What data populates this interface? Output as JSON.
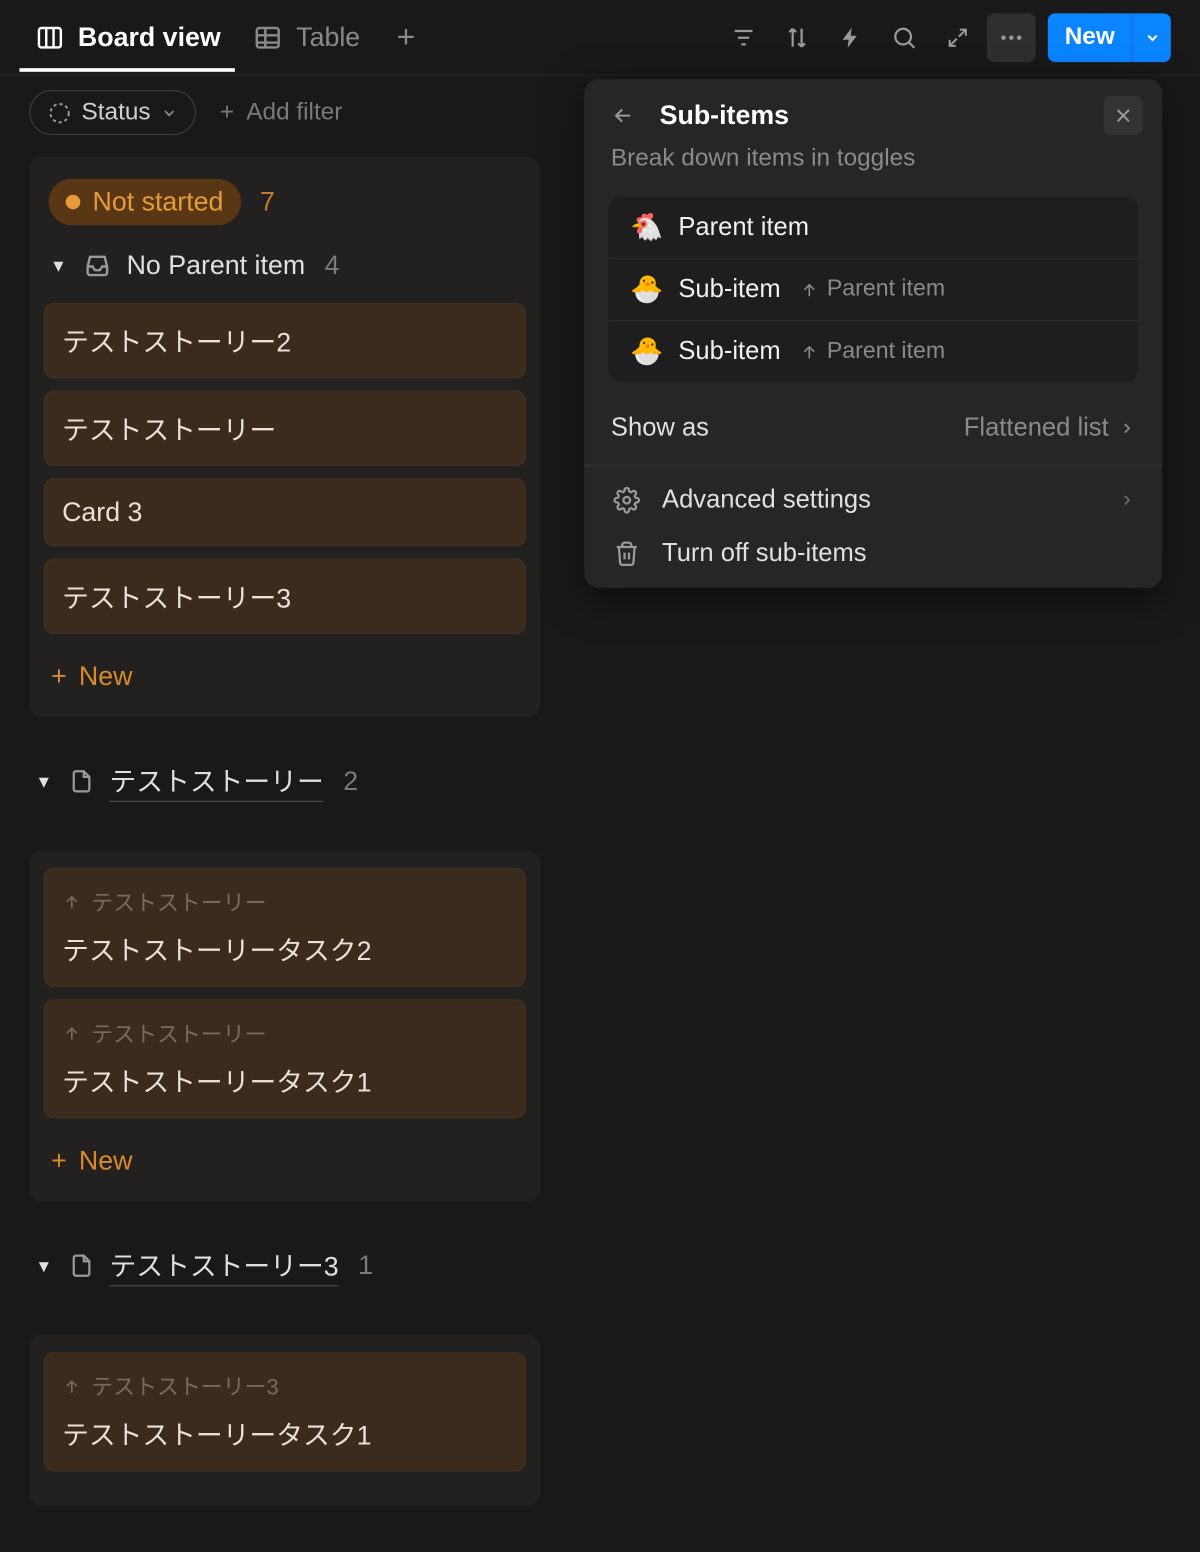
{
  "tabs": {
    "board": "Board view",
    "table": "Table"
  },
  "top": {
    "new_button": "New"
  },
  "filter_bar": {
    "status_chip": "Status",
    "add_filter": "Add filter"
  },
  "status": {
    "label": "Not started",
    "count": "7"
  },
  "groups": [
    {
      "icon": "inbox",
      "title": "No Parent item",
      "count": "4",
      "cards": [
        {
          "title": "テストストーリー2"
        },
        {
          "title": "テストストーリー"
        },
        {
          "title": "Card 3"
        },
        {
          "title": "テストストーリー3"
        }
      ]
    },
    {
      "icon": "page",
      "title": "テストストーリー",
      "count": "2",
      "cards": [
        {
          "parent": "テストストーリー",
          "title": "テストストーリータスク2"
        },
        {
          "parent": "テストストーリー",
          "title": "テストストーリータスク1"
        }
      ]
    },
    {
      "icon": "page",
      "title": "テストストーリー3",
      "count": "1",
      "cards": [
        {
          "parent": "テストストーリー3",
          "title": "テストストーリータスク1"
        }
      ]
    }
  ],
  "new_item": "New",
  "panel": {
    "title": "Sub-items",
    "subtitle": "Break down items in toggles",
    "rows": [
      {
        "emoji": "🐔",
        "label": "Parent item",
        "secondary": ""
      },
      {
        "emoji": "🐣",
        "label": "Sub-item",
        "secondary": "Parent item"
      },
      {
        "emoji": "🐣",
        "label": "Sub-item",
        "secondary": "Parent item"
      }
    ],
    "show_as_label": "Show as",
    "show_as_value": "Flattened list",
    "advanced": "Advanced settings",
    "turn_off": "Turn off sub-items"
  }
}
